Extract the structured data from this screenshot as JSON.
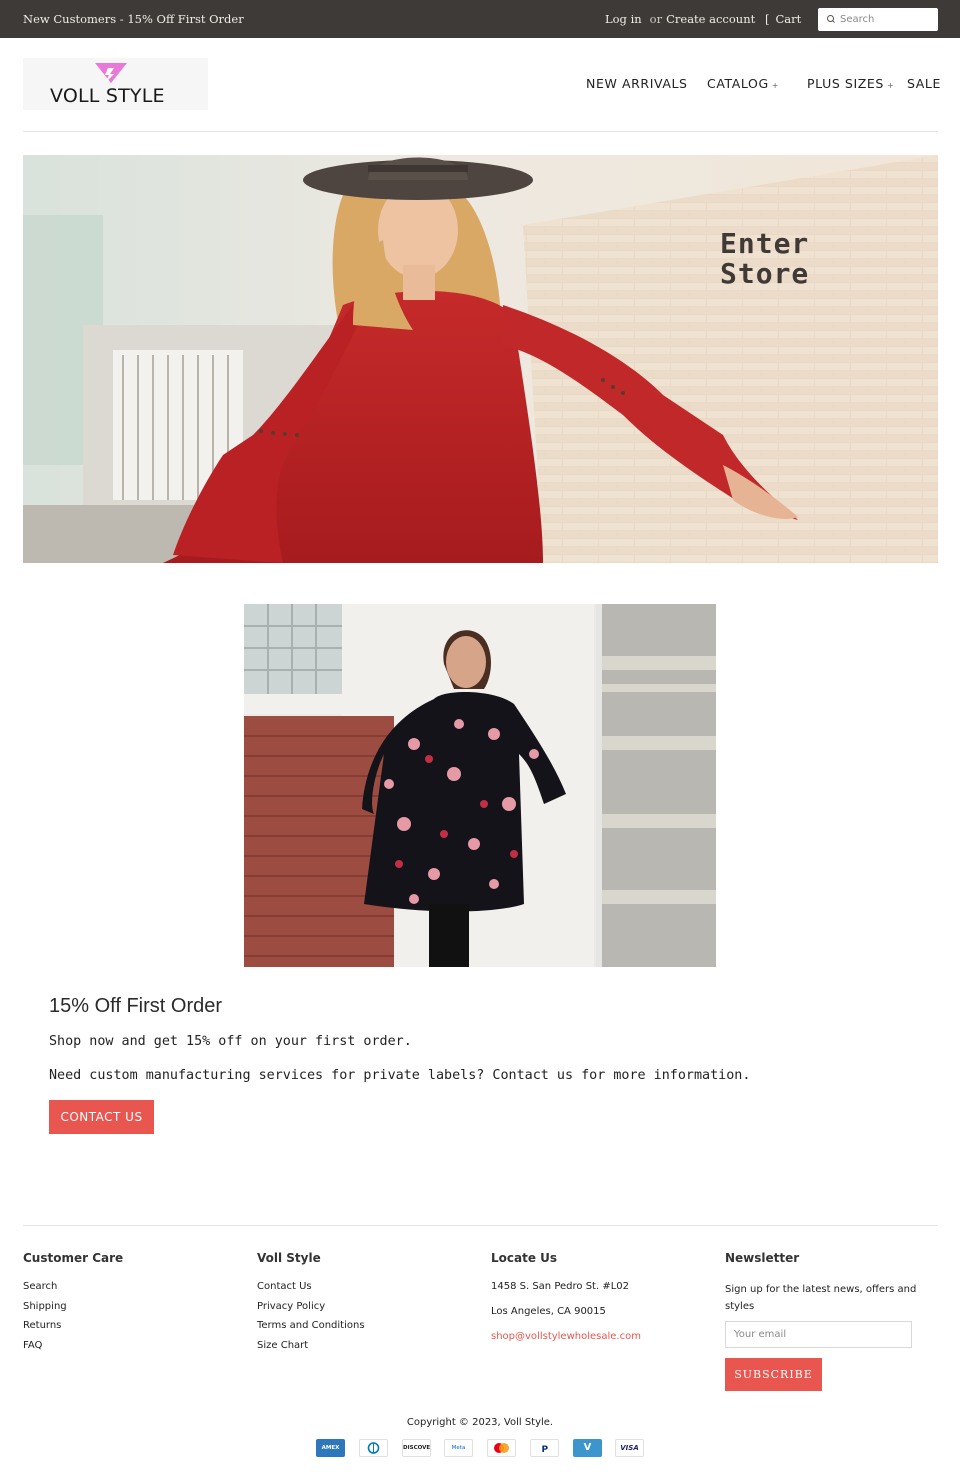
{
  "topbar": {
    "promo": "New Customers - 15% Off First Order",
    "login": "Log in",
    "or": "or",
    "create_account": "Create account",
    "cart": "Cart",
    "search_placeholder": "Search"
  },
  "header": {
    "logo_text": "VOLL STYLE",
    "nav": [
      {
        "label": "NEW ARRIVALS",
        "has_dropdown": false
      },
      {
        "label": "CATALOG",
        "has_dropdown": true
      },
      {
        "label": "PLUS SIZES",
        "has_dropdown": true
      },
      {
        "label": "SALE",
        "has_dropdown": false
      }
    ],
    "dropdown_glyph": "+"
  },
  "hero": {
    "title": "Enter\nStore"
  },
  "promo": {
    "heading": "15% Off First Order",
    "line1": "Shop now and get 15% off on your first order.",
    "line2": "Need custom manufacturing services for private labels? Contact us for more information.",
    "button": "CONTACT US"
  },
  "footer": {
    "customer_care": {
      "title": "Customer Care",
      "links": [
        "Search",
        "Shipping",
        "Returns",
        "FAQ"
      ]
    },
    "voll_style": {
      "title": "Voll Style",
      "links": [
        "Contact Us",
        "Privacy Policy",
        "Terms and Conditions",
        "Size Chart"
      ]
    },
    "locate_us": {
      "title": "Locate Us",
      "address1": "1458 S. San Pedro St. #L02",
      "address2": "Los Angeles, CA 90015",
      "email": "shop@vollstylewholesale.com"
    },
    "newsletter": {
      "title": "Newsletter",
      "text": "Sign up for the latest news, offers and styles",
      "email_placeholder": "Your email",
      "button": "SUBSCRIBE"
    },
    "copyright": "Copyright © 2023, Voll Style.",
    "payments": [
      "AMEX",
      "Diners",
      "DISCOVER",
      "Meta",
      "Mastercard",
      "PayPal",
      "V",
      "VISA"
    ]
  },
  "colors": {
    "topbar_bg": "#3d3a37",
    "accent": "#e8564f",
    "logo_pink": "#e879d9"
  }
}
